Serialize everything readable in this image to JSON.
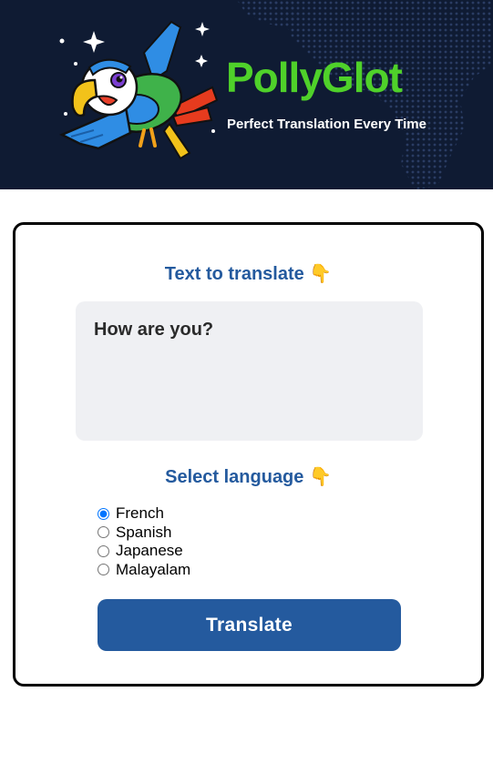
{
  "header": {
    "title": "PollyGlot",
    "tagline": "Perfect Translation Every Time",
    "logo_icon": "parrot-mascot-icon",
    "colors": {
      "background": "#0f1b33",
      "title": "#4fd12a",
      "tagline": "#ffffff"
    }
  },
  "form": {
    "text_heading": "Text to translate",
    "text_heading_emoji": "👇",
    "input_value": "How are you?",
    "language_heading": "Select language",
    "language_heading_emoji": "👇",
    "languages": [
      {
        "label": "French",
        "selected": true
      },
      {
        "label": "Spanish",
        "selected": false
      },
      {
        "label": "Japanese",
        "selected": false
      },
      {
        "label": "Malayalam",
        "selected": false
      }
    ],
    "submit_label": "Translate",
    "colors": {
      "accent": "#245a9e",
      "input_bg": "#eff0f3",
      "card_border": "#000000"
    }
  }
}
